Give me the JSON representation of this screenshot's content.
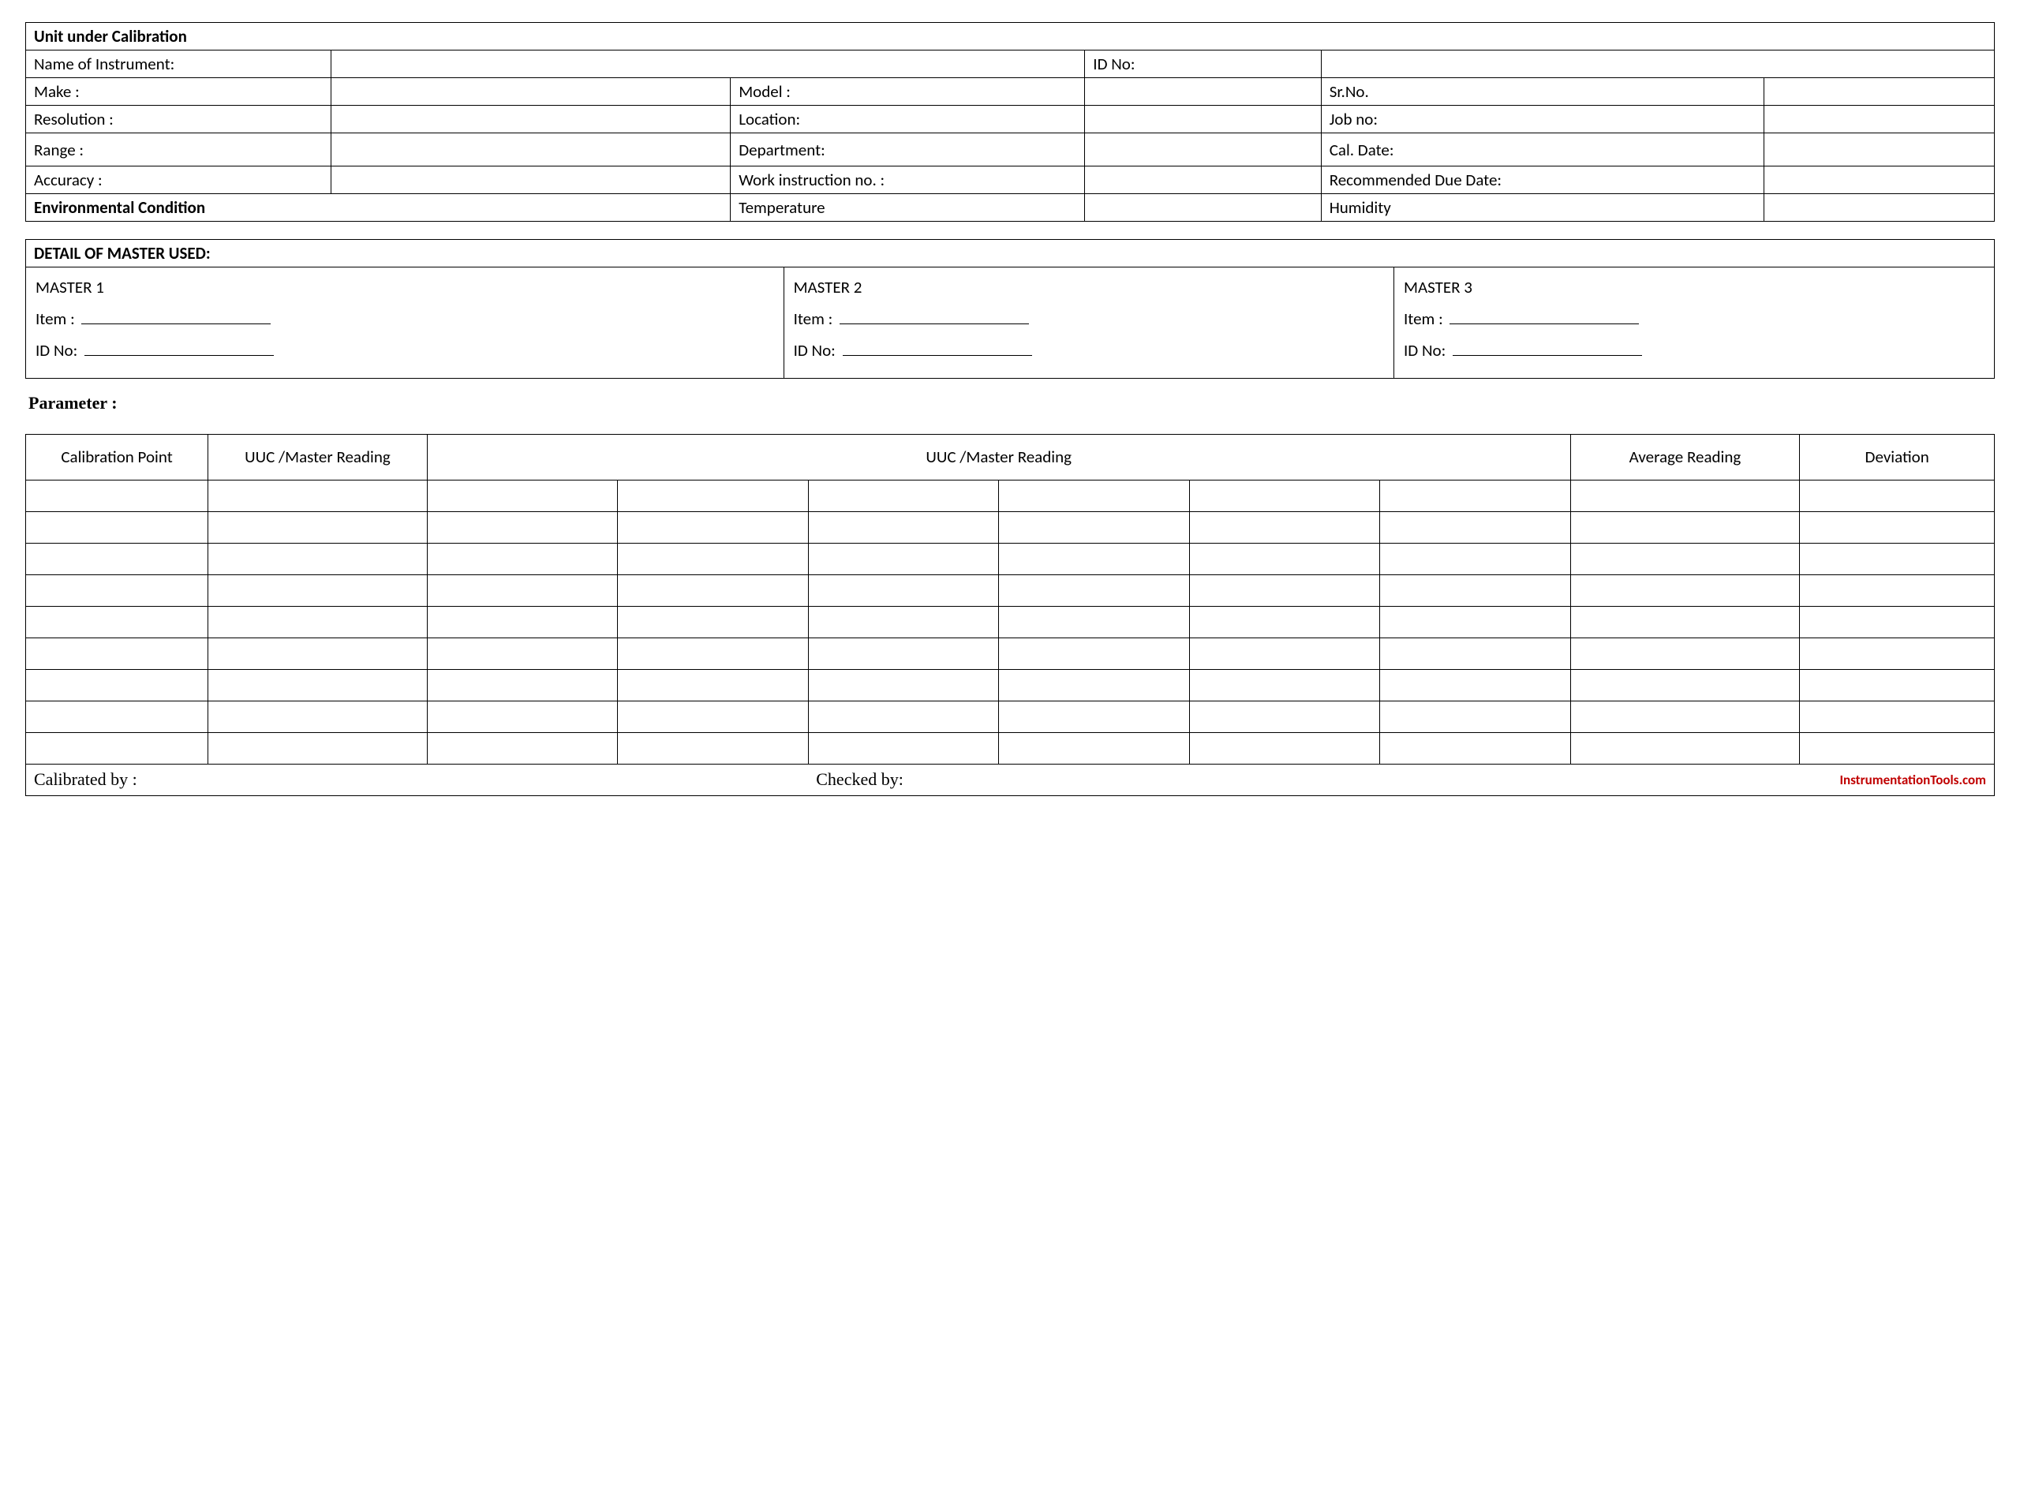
{
  "unit": {
    "heading": "Unit under Calibration",
    "name_label": "Name of Instrument:",
    "id_label": "ID No:",
    "make_label": "Make :",
    "model_label": "Model :",
    "srno_label": "Sr.No.",
    "resolution_label": "Resolution :",
    "location_label": "Location:",
    "jobno_label": "Job no:",
    "range_label": "Range :",
    "department_label": "Department:",
    "caldate_label": "Cal. Date:",
    "accuracy_label": "Accuracy :",
    "workinst_label": "Work instruction no. :",
    "duedate_label": "Recommended Due Date:",
    "envcond_label": "Environmental Condition",
    "temp_label": "Temperature",
    "humidity_label": "Humidity"
  },
  "master": {
    "heading": "DETAIL OF MASTER USED:",
    "m1_title": "MASTER 1",
    "m2_title": "MASTER 2",
    "m3_title": "MASTER 3",
    "item_label": "Item :",
    "id_label": "ID No:"
  },
  "parameter_label": "Parameter    :",
  "grid": {
    "calpoint": "Calibration Point",
    "uuc_master": "UUC /Master Reading",
    "uuc_master_wide": "UUC /Master Reading",
    "avg": "Average Reading",
    "dev": "Deviation"
  },
  "footer": {
    "calibrated_by": "Calibrated by :",
    "checked_by": "Checked by:",
    "source": "InstrumentationTools.com"
  }
}
